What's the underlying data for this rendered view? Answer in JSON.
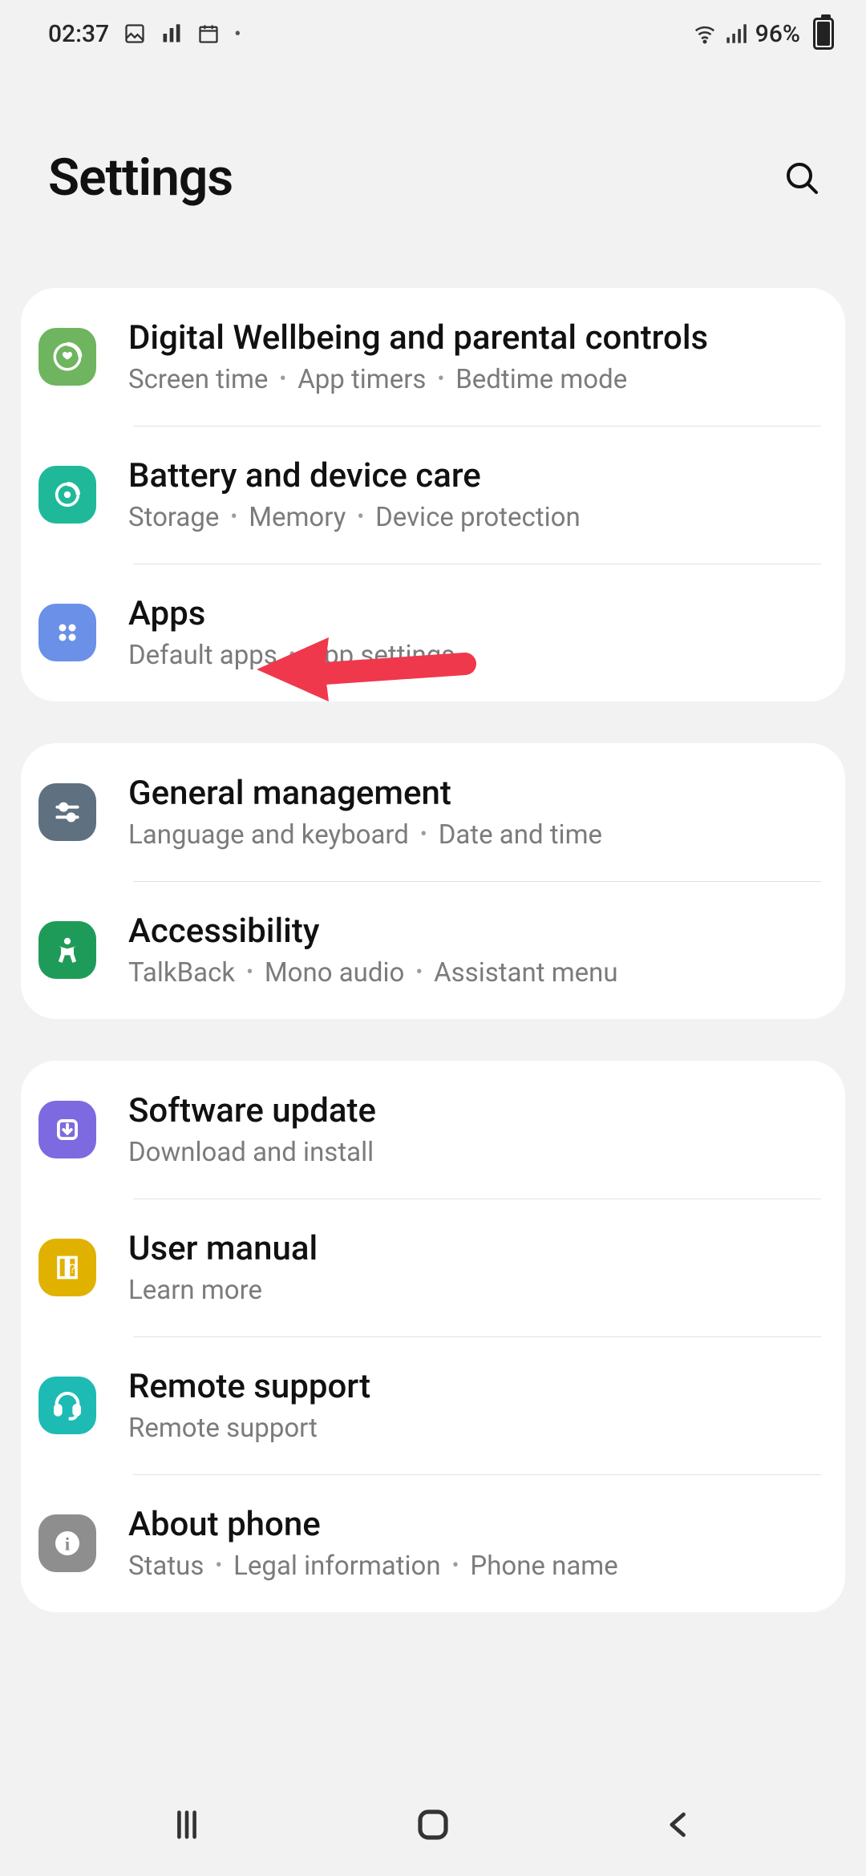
{
  "status": {
    "time": "02:37",
    "battery_pct": "96%"
  },
  "header": {
    "title": "Settings"
  },
  "groups": [
    {
      "rows": [
        {
          "icon": "wellbeing-icon",
          "title": "Digital Wellbeing and parental controls",
          "subs": [
            "Screen time",
            "App timers",
            "Bedtime mode"
          ]
        },
        {
          "icon": "device-care-icon",
          "title": "Battery and device care",
          "subs": [
            "Storage",
            "Memory",
            "Device protection"
          ]
        },
        {
          "icon": "apps-icon",
          "title": "Apps",
          "subs": [
            "Default apps",
            "App settings"
          ]
        }
      ]
    },
    {
      "rows": [
        {
          "icon": "general-management-icon",
          "title": "General management",
          "subs": [
            "Language and keyboard",
            "Date and time"
          ]
        },
        {
          "icon": "accessibility-icon",
          "title": "Accessibility",
          "subs": [
            "TalkBack",
            "Mono audio",
            "Assistant menu"
          ]
        }
      ]
    },
    {
      "rows": [
        {
          "icon": "software-update-icon",
          "title": "Software update",
          "subs": [
            "Download and install"
          ]
        },
        {
          "icon": "user-manual-icon",
          "title": "User manual",
          "subs": [
            "Learn more"
          ]
        },
        {
          "icon": "remote-support-icon",
          "title": "Remote support",
          "subs": [
            "Remote support"
          ]
        },
        {
          "icon": "about-phone-icon",
          "title": "About phone",
          "subs": [
            "Status",
            "Legal information",
            "Phone name"
          ]
        }
      ]
    }
  ],
  "annotation_target_row": "Apps",
  "colors": {
    "arrow": "#f0384c"
  }
}
